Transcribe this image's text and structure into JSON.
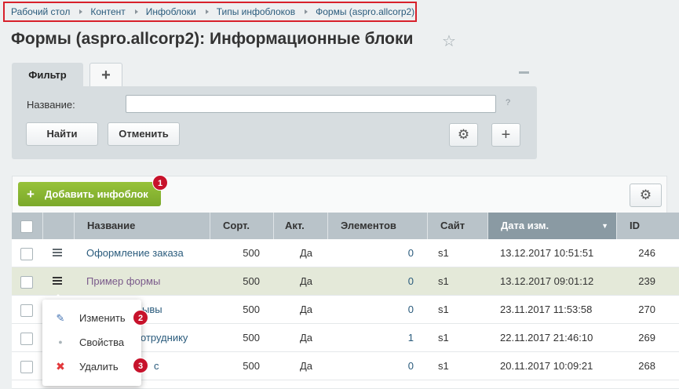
{
  "breadcrumb": [
    {
      "label": "Рабочий стол"
    },
    {
      "label": "Контент"
    },
    {
      "label": "Инфоблоки"
    },
    {
      "label": "Типы инфоблоков"
    },
    {
      "label": "Формы (aspro.allcorp2)"
    }
  ],
  "page_title": "Формы (aspro.allcorp2): Информационные блоки",
  "filter": {
    "tab_label": "Фильтр",
    "name_label": "Название:",
    "name_value": "",
    "help": "?",
    "find_button": "Найти",
    "cancel_button": "Отменить"
  },
  "toolbar": {
    "add_button": "Добавить инфоблок"
  },
  "badges": [
    "1",
    "2",
    "3"
  ],
  "table": {
    "columns": [
      "Название",
      "Сорт.",
      "Акт.",
      "Элементов",
      "Сайт",
      "Дата изм.",
      "ID"
    ],
    "sorted_column": "Дата изм.",
    "rows": [
      {
        "name": "Оформление заказа",
        "sort": "500",
        "active": "Да",
        "elements": "0",
        "site": "s1",
        "date": "13.12.2017 10:51:51",
        "id": "246"
      },
      {
        "name": "Пример формы",
        "sort": "500",
        "active": "Да",
        "elements": "0",
        "site": "s1",
        "date": "13.12.2017 09:01:12",
        "id": "239"
      },
      {
        "name": "ывы",
        "sort": "500",
        "active": "Да",
        "elements": "0",
        "site": "s1",
        "date": "23.11.2017 11:53:58",
        "id": "270"
      },
      {
        "name": "отруднику",
        "sort": "500",
        "active": "Да",
        "elements": "1",
        "site": "s1",
        "date": "22.11.2017 21:46:10",
        "id": "269"
      },
      {
        "name": "с",
        "sort": "500",
        "active": "Да",
        "elements": "0",
        "site": "s1",
        "date": "20.11.2017 10:09:21",
        "id": "268"
      }
    ]
  },
  "context_menu": [
    {
      "label": "Изменить",
      "icon": "edit-icon"
    },
    {
      "label": "Свойства",
      "icon": "dot-icon"
    },
    {
      "label": "Удалить",
      "icon": "delete-icon"
    }
  ],
  "colors": {
    "accent_green": "#86b532",
    "badge_red": "#c7122b",
    "highlight_border": "#d8212b",
    "link": "#2a5b7c"
  }
}
